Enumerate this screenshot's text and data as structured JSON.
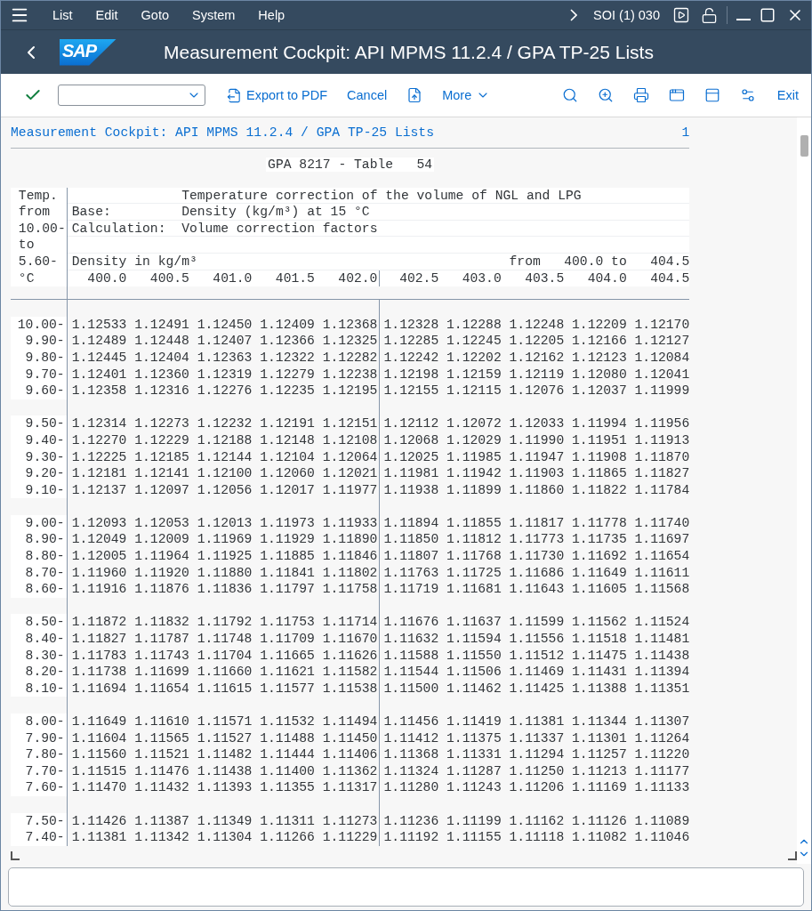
{
  "menu_bar": {
    "items": [
      "List",
      "Edit",
      "Goto",
      "System",
      "Help"
    ],
    "session": "SOI (1) 030"
  },
  "title_bar": {
    "logo": "SAP",
    "title": "Measurement Cockpit: API MPMS 11.2.4 / GPA TP-25 Lists"
  },
  "toolbar": {
    "buttons": [
      {
        "label": "Export to PDF"
      },
      {
        "label": "Cancel"
      }
    ],
    "more": "More",
    "exit": "Exit"
  },
  "list": {
    "heading": "Measurement Cockpit: API MPMS 11.2.4 / GPA TP-25 Lists",
    "page": "1",
    "table_title": "GPA 8217 - Table   54",
    "header": {
      "temp_labels": [
        "Temp.",
        "from",
        "10.00-",
        "to",
        "5.60-",
        "°C"
      ],
      "description": "Temperature correction of the volume of NGL and LPG",
      "fields": [
        {
          "key": "Base:",
          "value": "Density (kg/m³) at 15 °C"
        },
        {
          "key": "Calculation:",
          "value": "Volume correction factors"
        }
      ],
      "density_label": "Density in kg/m³",
      "range": "from   400.0 to   404.5",
      "columns": [
        "400.0",
        "400.5",
        "401.0",
        "401.5",
        "402.0",
        "402.5",
        "403.0",
        "403.5",
        "404.0",
        "404.5"
      ]
    },
    "groups": [
      {
        "rows": [
          {
            "temp": "10.00-",
            "values": [
              "1.12533",
              "1.12491",
              "1.12450",
              "1.12409",
              "1.12368",
              "1.12328",
              "1.12288",
              "1.12248",
              "1.12209",
              "1.12170"
            ]
          },
          {
            "temp": "9.90-",
            "values": [
              "1.12489",
              "1.12448",
              "1.12407",
              "1.12366",
              "1.12325",
              "1.12285",
              "1.12245",
              "1.12205",
              "1.12166",
              "1.12127"
            ]
          },
          {
            "temp": "9.80-",
            "values": [
              "1.12445",
              "1.12404",
              "1.12363",
              "1.12322",
              "1.12282",
              "1.12242",
              "1.12202",
              "1.12162",
              "1.12123",
              "1.12084"
            ]
          },
          {
            "temp": "9.70-",
            "values": [
              "1.12401",
              "1.12360",
              "1.12319",
              "1.12279",
              "1.12238",
              "1.12198",
              "1.12159",
              "1.12119",
              "1.12080",
              "1.12041"
            ]
          },
          {
            "temp": "9.60-",
            "values": [
              "1.12358",
              "1.12316",
              "1.12276",
              "1.12235",
              "1.12195",
              "1.12155",
              "1.12115",
              "1.12076",
              "1.12037",
              "1.11999"
            ]
          }
        ]
      },
      {
        "rows": [
          {
            "temp": "9.50-",
            "values": [
              "1.12314",
              "1.12273",
              "1.12232",
              "1.12191",
              "1.12151",
              "1.12112",
              "1.12072",
              "1.12033",
              "1.11994",
              "1.11956"
            ]
          },
          {
            "temp": "9.40-",
            "values": [
              "1.12270",
              "1.12229",
              "1.12188",
              "1.12148",
              "1.12108",
              "1.12068",
              "1.12029",
              "1.11990",
              "1.11951",
              "1.11913"
            ]
          },
          {
            "temp": "9.30-",
            "values": [
              "1.12225",
              "1.12185",
              "1.12144",
              "1.12104",
              "1.12064",
              "1.12025",
              "1.11985",
              "1.11947",
              "1.11908",
              "1.11870"
            ]
          },
          {
            "temp": "9.20-",
            "values": [
              "1.12181",
              "1.12141",
              "1.12100",
              "1.12060",
              "1.12021",
              "1.11981",
              "1.11942",
              "1.11903",
              "1.11865",
              "1.11827"
            ]
          },
          {
            "temp": "9.10-",
            "values": [
              "1.12137",
              "1.12097",
              "1.12056",
              "1.12017",
              "1.11977",
              "1.11938",
              "1.11899",
              "1.11860",
              "1.11822",
              "1.11784"
            ]
          }
        ]
      },
      {
        "rows": [
          {
            "temp": "9.00-",
            "values": [
              "1.12093",
              "1.12053",
              "1.12013",
              "1.11973",
              "1.11933",
              "1.11894",
              "1.11855",
              "1.11817",
              "1.11778",
              "1.11740"
            ]
          },
          {
            "temp": "8.90-",
            "values": [
              "1.12049",
              "1.12009",
              "1.11969",
              "1.11929",
              "1.11890",
              "1.11850",
              "1.11812",
              "1.11773",
              "1.11735",
              "1.11697"
            ]
          },
          {
            "temp": "8.80-",
            "values": [
              "1.12005",
              "1.11964",
              "1.11925",
              "1.11885",
              "1.11846",
              "1.11807",
              "1.11768",
              "1.11730",
              "1.11692",
              "1.11654"
            ]
          },
          {
            "temp": "8.70-",
            "values": [
              "1.11960",
              "1.11920",
              "1.11880",
              "1.11841",
              "1.11802",
              "1.11763",
              "1.11725",
              "1.11686",
              "1.11649",
              "1.11611"
            ]
          },
          {
            "temp": "8.60-",
            "values": [
              "1.11916",
              "1.11876",
              "1.11836",
              "1.11797",
              "1.11758",
              "1.11719",
              "1.11681",
              "1.11643",
              "1.11605",
              "1.11568"
            ]
          }
        ]
      },
      {
        "rows": [
          {
            "temp": "8.50-",
            "values": [
              "1.11872",
              "1.11832",
              "1.11792",
              "1.11753",
              "1.11714",
              "1.11676",
              "1.11637",
              "1.11599",
              "1.11562",
              "1.11524"
            ]
          },
          {
            "temp": "8.40-",
            "values": [
              "1.11827",
              "1.11787",
              "1.11748",
              "1.11709",
              "1.11670",
              "1.11632",
              "1.11594",
              "1.11556",
              "1.11518",
              "1.11481"
            ]
          },
          {
            "temp": "8.30-",
            "values": [
              "1.11783",
              "1.11743",
              "1.11704",
              "1.11665",
              "1.11626",
              "1.11588",
              "1.11550",
              "1.11512",
              "1.11475",
              "1.11438"
            ]
          },
          {
            "temp": "8.20-",
            "values": [
              "1.11738",
              "1.11699",
              "1.11660",
              "1.11621",
              "1.11582",
              "1.11544",
              "1.11506",
              "1.11469",
              "1.11431",
              "1.11394"
            ]
          },
          {
            "temp": "8.10-",
            "values": [
              "1.11694",
              "1.11654",
              "1.11615",
              "1.11577",
              "1.11538",
              "1.11500",
              "1.11462",
              "1.11425",
              "1.11388",
              "1.11351"
            ]
          }
        ]
      },
      {
        "rows": [
          {
            "temp": "8.00-",
            "values": [
              "1.11649",
              "1.11610",
              "1.11571",
              "1.11532",
              "1.11494",
              "1.11456",
              "1.11419",
              "1.11381",
              "1.11344",
              "1.11307"
            ]
          },
          {
            "temp": "7.90-",
            "values": [
              "1.11604",
              "1.11565",
              "1.11527",
              "1.11488",
              "1.11450",
              "1.11412",
              "1.11375",
              "1.11337",
              "1.11301",
              "1.11264"
            ]
          },
          {
            "temp": "7.80-",
            "values": [
              "1.11560",
              "1.11521",
              "1.11482",
              "1.11444",
              "1.11406",
              "1.11368",
              "1.11331",
              "1.11294",
              "1.11257",
              "1.11220"
            ]
          },
          {
            "temp": "7.70-",
            "values": [
              "1.11515",
              "1.11476",
              "1.11438",
              "1.11400",
              "1.11362",
              "1.11324",
              "1.11287",
              "1.11250",
              "1.11213",
              "1.11177"
            ]
          },
          {
            "temp": "7.60-",
            "values": [
              "1.11470",
              "1.11432",
              "1.11393",
              "1.11355",
              "1.11317",
              "1.11280",
              "1.11243",
              "1.11206",
              "1.11169",
              "1.11133"
            ]
          }
        ]
      },
      {
        "rows": [
          {
            "temp": "7.50-",
            "values": [
              "1.11426",
              "1.11387",
              "1.11349",
              "1.11311",
              "1.11273",
              "1.11236",
              "1.11199",
              "1.11162",
              "1.11126",
              "1.11089"
            ]
          },
          {
            "temp": "7.40-",
            "values": [
              "1.11381",
              "1.11342",
              "1.11304",
              "1.11266",
              "1.11229",
              "1.11192",
              "1.11155",
              "1.11118",
              "1.11082",
              "1.11046"
            ]
          }
        ]
      }
    ]
  }
}
